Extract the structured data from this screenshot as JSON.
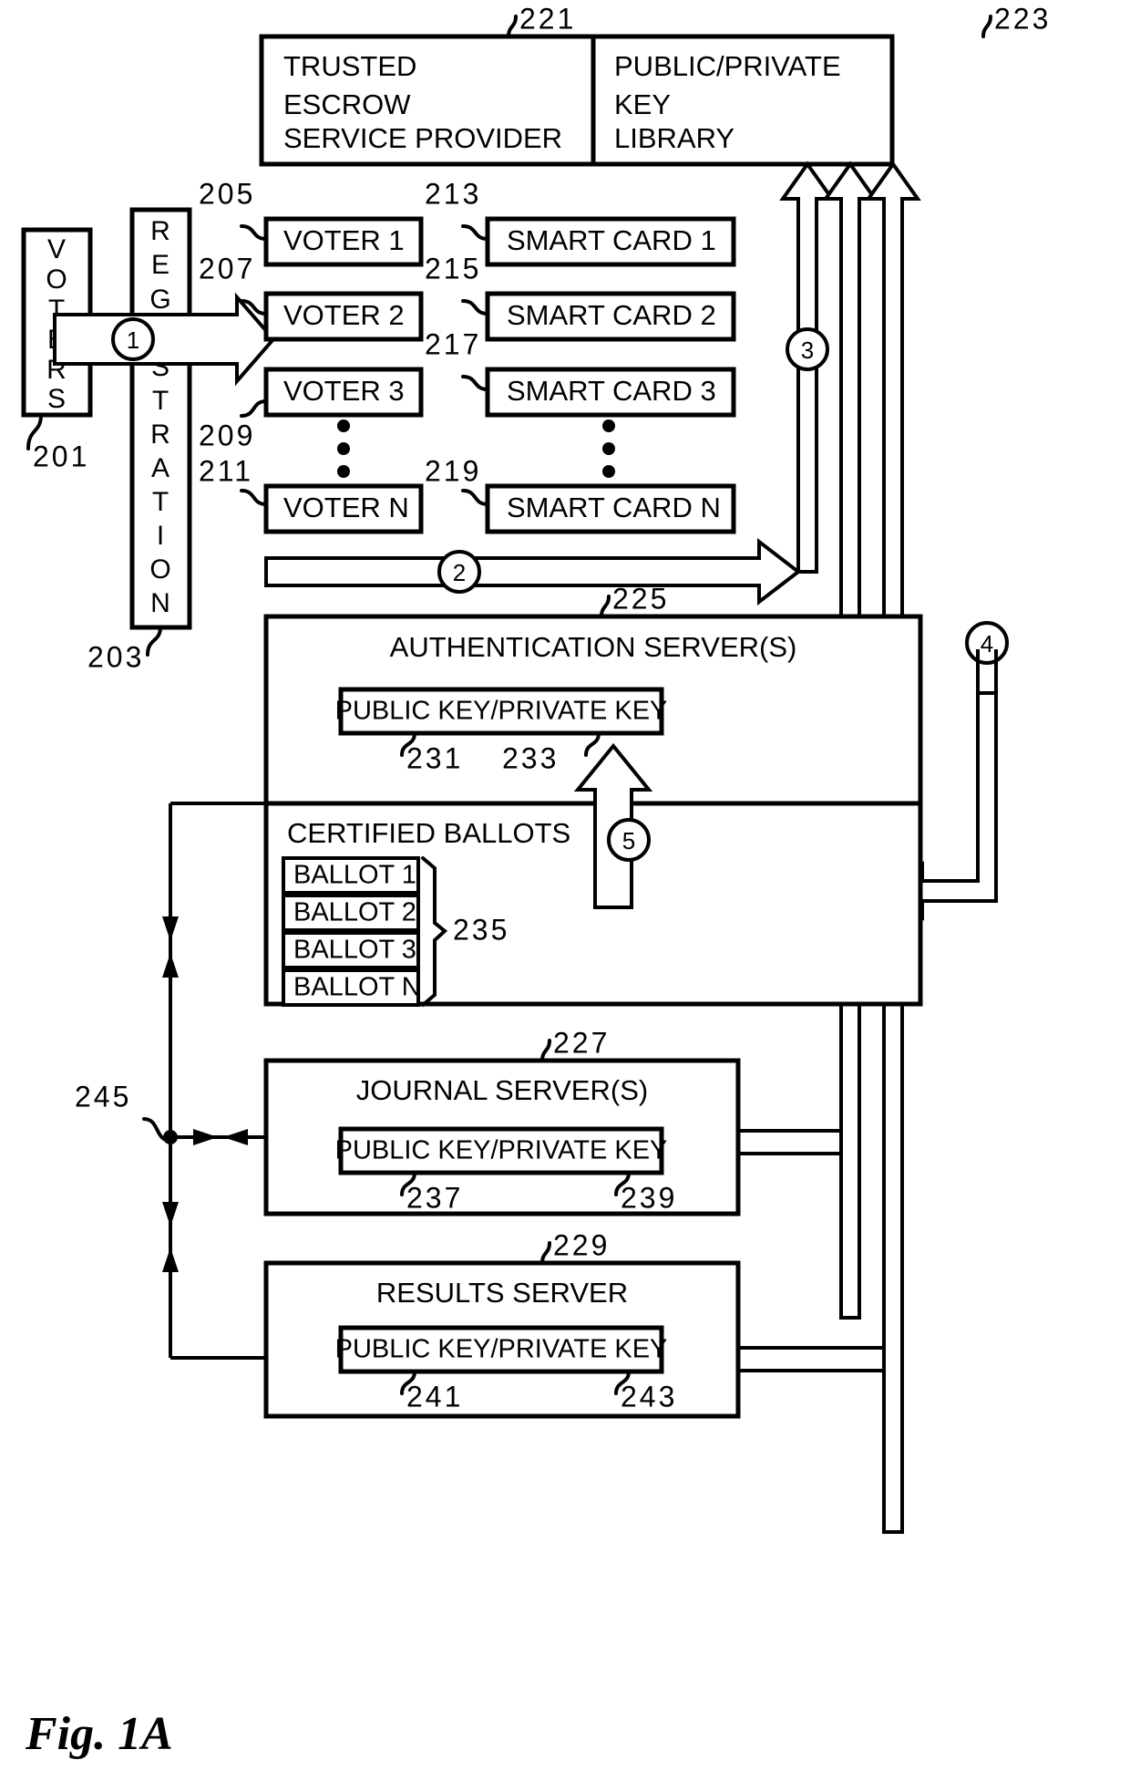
{
  "figure": {
    "caption": "Fig.  1A"
  },
  "top_panel": {
    "left_box": {
      "ref": "221",
      "lines": [
        "TRUSTED",
        "ESCROW",
        "SERVICE PROVIDER"
      ]
    },
    "right_box": {
      "ref": "223",
      "lines": [
        "PUBLIC/PRIVATE",
        "KEY",
        "LIBRARY"
      ]
    }
  },
  "voters_block": {
    "ref": "201",
    "label": "VOTERS",
    "letters": [
      "V",
      "O",
      "T",
      "E",
      "R",
      "S"
    ]
  },
  "registration_block": {
    "ref": "203",
    "label": "REGISTRATION",
    "letters": [
      "R",
      "E",
      "G",
      "I",
      "S",
      "T",
      "R",
      "A",
      "T",
      "I",
      "O",
      "N"
    ]
  },
  "voters": [
    {
      "ref": "205",
      "label": "VOTER 1"
    },
    {
      "ref": "207",
      "label": "VOTER 2"
    },
    {
      "ref": "209",
      "label": "VOTER 3"
    },
    {
      "ref": "211",
      "label": "VOTER N"
    }
  ],
  "smart_cards": [
    {
      "ref": "213",
      "label": "SMART CARD 1"
    },
    {
      "ref": "215",
      "label": "SMART CARD 2"
    },
    {
      "ref": "217",
      "label": "SMART CARD 3"
    },
    {
      "ref": "219",
      "label": "SMART CARD N"
    }
  ],
  "ellipsis": "vertical-dots",
  "auth_server": {
    "ref": "225",
    "title": "AUTHENTICATION SERVER(S)",
    "key_box": {
      "label": "PUBLIC KEY/PRIVATE KEY",
      "public_ref": "231",
      "private_ref": "233"
    },
    "ballots_section": {
      "title": "CERTIFIED BALLOTS",
      "ref": "235",
      "items": [
        "BALLOT 1",
        "BALLOT 2",
        "BALLOT 3",
        "BALLOT N"
      ]
    }
  },
  "journal_server": {
    "ref": "227",
    "title": "JOURNAL SERVER(S)",
    "key_box": {
      "label": "PUBLIC KEY/PRIVATE KEY",
      "public_ref": "237",
      "private_ref": "239"
    }
  },
  "results_server": {
    "ref": "229",
    "title": "RESULTS SERVER",
    "key_box": {
      "label": "PUBLIC KEY/PRIVATE KEY",
      "public_ref": "241",
      "private_ref": "243"
    }
  },
  "bus": {
    "ref": "245"
  },
  "steps": {
    "s1": "1",
    "s2": "2",
    "s3": "3",
    "s4": "4",
    "s5": "5"
  }
}
